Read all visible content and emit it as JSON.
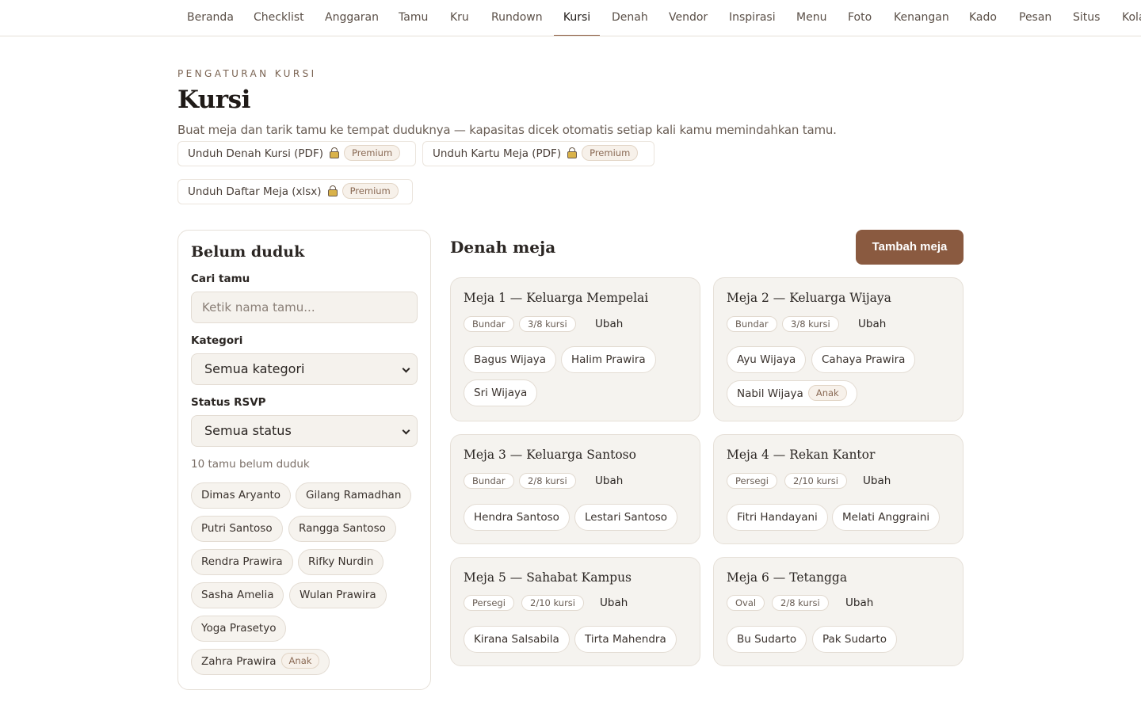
{
  "nav": {
    "items": [
      "Beranda",
      "Checklist",
      "Anggaran",
      "Tamu",
      "Kru",
      "Rundown",
      "Kursi",
      "Denah",
      "Vendor",
      "Inspirasi",
      "Menu",
      "Foto",
      "Kenangan",
      "Kado",
      "Pesan",
      "Situs",
      "Kola"
    ],
    "active": "Kursi"
  },
  "header": {
    "eyebrow": "PENGATURAN KURSI",
    "title": "Kursi",
    "subtitle": "Buat meja dan tarik tamu ke tempat duduknya — kapasitas dicek otomatis setiap kali kamu memindahkan tamu."
  },
  "downloads": [
    {
      "label": "Unduh Denah Kursi (PDF)",
      "badge": "Premium"
    },
    {
      "label": "Unduh Kartu Meja (PDF)",
      "badge": "Premium"
    },
    {
      "label": "Unduh Daftar Meja (xlsx)",
      "badge": "Premium"
    }
  ],
  "unseated": {
    "title": "Belum duduk",
    "search_label": "Cari tamu",
    "search_placeholder": "Ketik nama tamu...",
    "category_label": "Kategori",
    "category_value": "Semua kategori",
    "status_label": "Status RSVP",
    "status_value": "Semua status",
    "count": "10 tamu belum duduk",
    "guests": [
      {
        "name": "Dimas Aryanto"
      },
      {
        "name": "Gilang Ramadhan"
      },
      {
        "name": "Putri Santoso"
      },
      {
        "name": "Rangga Santoso"
      },
      {
        "name": "Rendra Prawira"
      },
      {
        "name": "Rifky Nurdin"
      },
      {
        "name": "Sasha Amelia"
      },
      {
        "name": "Wulan Prawira"
      },
      {
        "name": "Yoga Prasetyo"
      },
      {
        "name": "Zahra Prawira",
        "badge": "Anak"
      }
    ]
  },
  "layout": {
    "title": "Denah meja",
    "add_label": "Tambah meja",
    "edit_label": "Ubah",
    "tables": [
      {
        "name": "Meja 1 — Keluarga Mempelai",
        "shape": "Bundar",
        "capacity": "3/8 kursi",
        "guests": [
          {
            "name": "Bagus Wijaya"
          },
          {
            "name": "Halim Prawira"
          },
          {
            "name": "Sri Wijaya"
          }
        ]
      },
      {
        "name": "Meja 2 — Keluarga Wijaya",
        "shape": "Bundar",
        "capacity": "3/8 kursi",
        "guests": [
          {
            "name": "Ayu Wijaya"
          },
          {
            "name": "Cahaya Prawira"
          },
          {
            "name": "Nabil Wijaya",
            "badge": "Anak"
          }
        ]
      },
      {
        "name": "Meja 3 — Keluarga Santoso",
        "shape": "Bundar",
        "capacity": "2/8 kursi",
        "guests": [
          {
            "name": "Hendra Santoso"
          },
          {
            "name": "Lestari Santoso"
          }
        ]
      },
      {
        "name": "Meja 4 — Rekan Kantor",
        "shape": "Persegi",
        "capacity": "2/10 kursi",
        "guests": [
          {
            "name": "Fitri Handayani"
          },
          {
            "name": "Melati Anggraini"
          }
        ]
      },
      {
        "name": "Meja 5 — Sahabat Kampus",
        "shape": "Persegi",
        "capacity": "2/10 kursi",
        "guests": [
          {
            "name": "Kirana Salsabila"
          },
          {
            "name": "Tirta Mahendra"
          }
        ]
      },
      {
        "name": "Meja 6 — Tetangga",
        "shape": "Oval",
        "capacity": "2/8 kursi",
        "guests": [
          {
            "name": "Bu Sudarto"
          },
          {
            "name": "Pak Sudarto"
          }
        ]
      }
    ]
  }
}
